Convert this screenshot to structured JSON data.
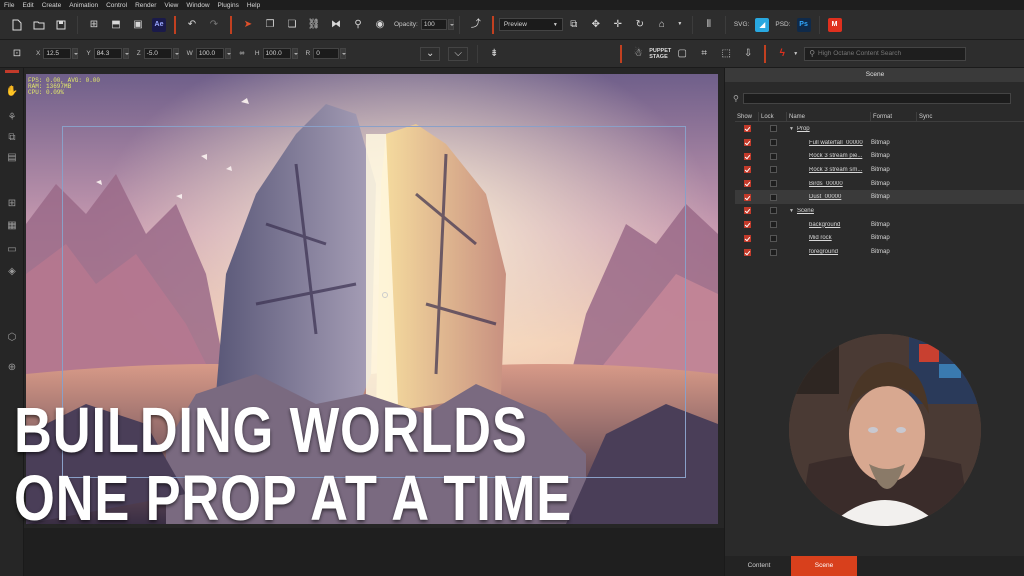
{
  "menu": [
    "File",
    "Edit",
    "Create",
    "Animation",
    "Control",
    "Render",
    "View",
    "Window",
    "Plugins",
    "Help"
  ],
  "toolbar": {
    "opacity_label": "Opacity:",
    "opacity_value": "100",
    "preview_label": "Preview",
    "svg_label": "SVG:",
    "psd_label": "PSD:",
    "ae_badge": "Ae",
    "ps_badge": "Ps",
    "m_badge": "M"
  },
  "transform": {
    "x_label": "X",
    "x_value": "12.5",
    "y_label": "Y",
    "y_value": "84.3",
    "z_label": "Z",
    "z_value": "-5.0",
    "w_label": "W",
    "w_value": "100.0",
    "h_label": "H",
    "h_value": "100.0",
    "r_label": "R",
    "r_value": "0",
    "puppet_label_1": "PUPPET",
    "puppet_label_2": "STAGE",
    "search_placeholder": "High Octane Content Search"
  },
  "stage": {
    "stats": "FPS: 0.00, AVG: 0.00\nRAM: 13697MB\nCPU: 0.09%"
  },
  "headline": {
    "line1": "BUILDING WORLDS",
    "line2": "ONE PROP AT A TIME"
  },
  "scene_panel": {
    "title": "Scene",
    "columns": [
      "Show",
      "Lock",
      "Name",
      "Format",
      "Sync"
    ],
    "rows": [
      {
        "name": "Prop",
        "format": "",
        "group": true,
        "show": true,
        "lock": false
      },
      {
        "name": "Full waterfall_00000",
        "format": "Bitmap",
        "group": false,
        "show": true,
        "lock": false
      },
      {
        "name": "Rock 3 stream pie...",
        "format": "Bitmap",
        "group": false,
        "show": true,
        "lock": false
      },
      {
        "name": "Rock 3 stream sm...",
        "format": "Bitmap",
        "group": false,
        "show": true,
        "lock": false
      },
      {
        "name": "Birds_00000",
        "format": "Bitmap",
        "group": false,
        "show": true,
        "lock": false
      },
      {
        "name": "Dust_00000",
        "format": "Bitmap",
        "group": false,
        "show": true,
        "lock": false,
        "selected": true
      },
      {
        "name": "Scene",
        "format": "",
        "group": true,
        "show": true,
        "lock": false
      },
      {
        "name": "background",
        "format": "Bitmap",
        "group": false,
        "show": true,
        "lock": false
      },
      {
        "name": "Mid rock",
        "format": "Bitmap",
        "group": false,
        "show": true,
        "lock": false
      },
      {
        "name": "foreground",
        "format": "Bitmap",
        "group": false,
        "show": true,
        "lock": false
      }
    ],
    "tabs": [
      "Content",
      "Scene"
    ],
    "active_tab": "Scene"
  },
  "colors": {
    "accent": "#d8401c",
    "panel_bg": "#2a2a2a",
    "headline": "#ffffff"
  }
}
